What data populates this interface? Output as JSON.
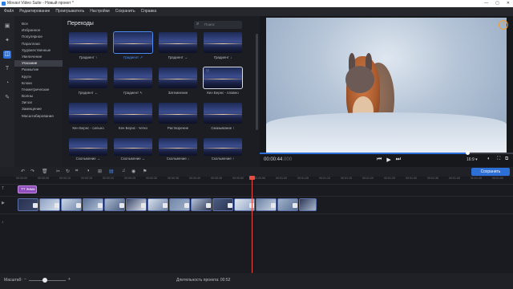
{
  "window": {
    "title": "Movavi Video Suite - Новый проект *",
    "controls": [
      "—",
      "▢",
      "✕"
    ]
  },
  "menu": [
    "Файл",
    "Редактирование",
    "Проигрыватель",
    "Настройки",
    "Сохранить",
    "Справка"
  ],
  "leftbar": {
    "icons": [
      "import-icon",
      "filters-icon",
      "transitions-icon",
      "titles-icon",
      "stickers-icon",
      "more-icon"
    ]
  },
  "categories": [
    "Все",
    "Избранное",
    "Популярное",
    "Параллакс",
    "Художественные",
    "Увеличение",
    "Угасание",
    "Размытие",
    "Круги",
    "Блоки",
    "Геометрические",
    "Волны",
    "Зигзаг",
    "Замещение",
    "Масштабирование"
  ],
  "active_category": 6,
  "browser": {
    "heading": "Переходы",
    "search_placeholder": "Поиск",
    "tiles": [
      "Градиент ↑",
      "Градиент ↗",
      "Градиент →",
      "Градиент ↓",
      "Градиент ←",
      "Градиент ↖",
      "Затемнение",
      "Кен Бернс - плавно",
      "Кен Бернс - сильно",
      "Кен Бернс - четко",
      "Растворение",
      "Смазывание ↑",
      "Скольжение →",
      "Скольжение ←",
      "Скольжение ↓",
      "Скольжение ↑"
    ],
    "selected_tile": 1,
    "hovered_tile": 7
  },
  "preview": {
    "timecode": "00:00:44",
    "timecode_ms": ".000",
    "ratio": "16:9 ▾",
    "progress": 0.82
  },
  "export_label": "Сохранить",
  "timeline": {
    "ticks": [
      "00:00:00",
      "00:00:05",
      "00:00:10",
      "00:00:15",
      "00:00:20",
      "00:00:25",
      "00:00:30",
      "00:00:35",
      "00:00:40",
      "00:00:45",
      "00:00:50",
      "00:00:55",
      "00:01:00",
      "00:01:05",
      "00:01:10",
      "00:01:15",
      "00:01:20",
      "00:01:25",
      "00:01:30",
      "00:01:35",
      "00:01:40",
      "00:01:45",
      "00:01:50",
      "00:01:55"
    ],
    "title_clip": "TT Зима",
    "clip_count": 14
  },
  "status": {
    "zoom_label": "Масштаб:",
    "duration": "Длительность проекта: 00:52"
  }
}
